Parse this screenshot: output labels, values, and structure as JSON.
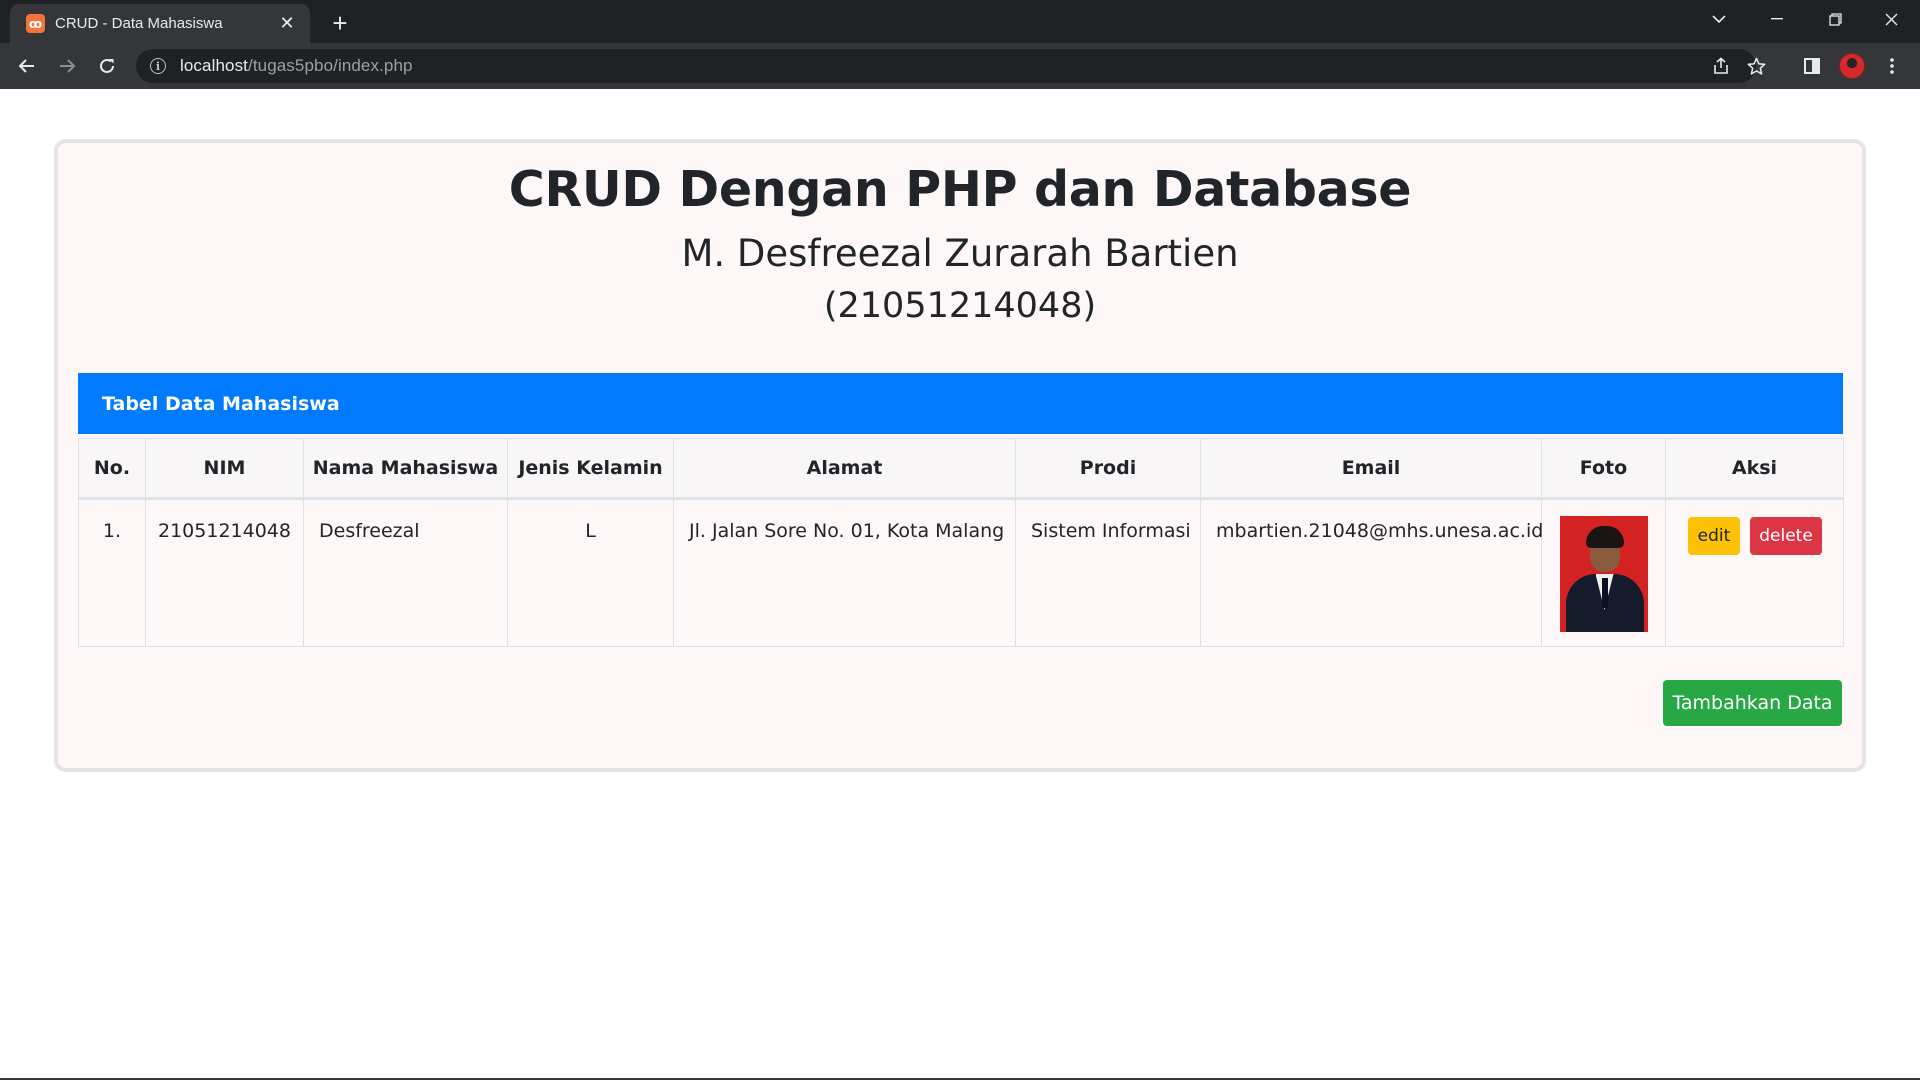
{
  "browser": {
    "tab_title": "CRUD - Data Mahasiswa",
    "favicon_label": "ꝏ",
    "new_tab_label": "+",
    "url_host": "localhost",
    "url_path": "/tugas5pbo/index.php"
  },
  "page": {
    "title": "CRUD Dengan PHP dan Database",
    "author_name": "M. Desfreezal Zurarah Bartien",
    "author_nim": "(21051214048)",
    "panel_title": "Tabel Data Mahasiswa",
    "columns": [
      "No.",
      "NIM",
      "Nama Mahasiswa",
      "Jenis Kelamin",
      "Alamat",
      "Prodi",
      "Email",
      "Foto",
      "Aksi"
    ],
    "rows": [
      {
        "no": "1.",
        "nim": "21051214048",
        "nama": "Desfreezal",
        "jenis_kelamin": "L",
        "alamat": "Jl. Jalan Sore No. 01, Kota Malang",
        "prodi": "Sistem Informasi",
        "email": "mbartien.21048@mhs.unesa.ac.id",
        "edit_label": "edit",
        "delete_label": "delete"
      }
    ],
    "add_button_label": "Tambahkan Data"
  },
  "colors": {
    "panel_header": "#007bff",
    "edit_button": "#ffc107",
    "delete_button": "#dc3545",
    "add_button": "#28a745"
  },
  "icons": [
    "info-icon",
    "back-icon",
    "forward-icon",
    "reload-icon",
    "share-icon",
    "star-icon",
    "sidepanel-icon",
    "menu-icon",
    "tab-list-icon",
    "minimize-icon",
    "restore-icon",
    "close-icon"
  ]
}
